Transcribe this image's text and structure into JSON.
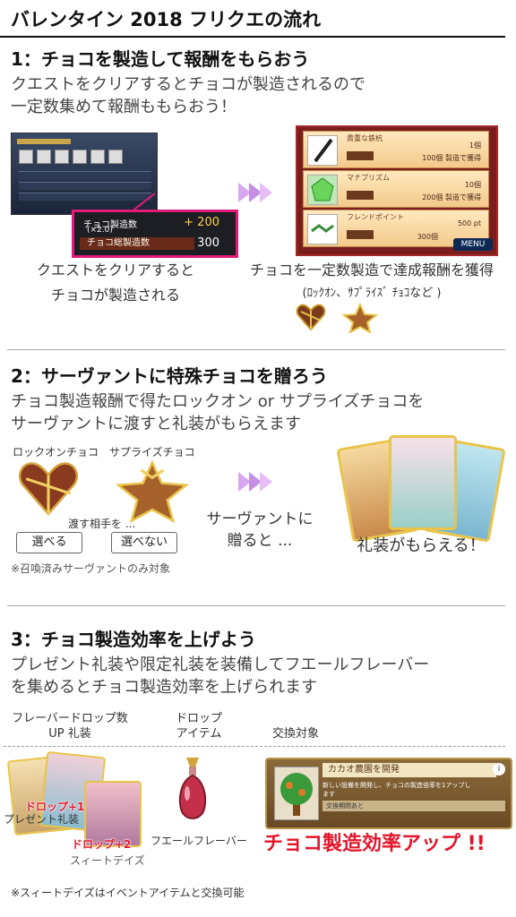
{
  "page": {
    "title": "バレンタイン 2018 フリクエの流れ"
  },
  "section1": {
    "heading": "1：チョコを製造して報酬をもらおう",
    "desc_line1": "クエストをクリアするとチョコが製造されるので",
    "desc_line2": "一定数集めて報酬ももらおう！",
    "panel": {
      "label1": "チョコ製造数",
      "label1b": "(×2.0)",
      "value1": "+ 200",
      "label2": "チョコ総製造数",
      "value2": "300"
    },
    "reward_screen": {
      "items": [
        {
          "name": "貴重な鉄杭",
          "qty": "1個",
          "progress": "100個 製造で獲得"
        },
        {
          "name": "マナプリズム",
          "qty": "10個",
          "progress": "200個 製造で獲得"
        },
        {
          "name": "フレンドポイント",
          "qty": "500 pt",
          "progress": "300個"
        }
      ],
      "menu_label": "MENU"
    },
    "caption_left_line1": "クエストをクリアすると",
    "caption_left_line2": "チョコが製造される",
    "caption_right_line1": "チョコを一定数製造で達成報酬を獲得",
    "caption_right_line2": "(ﾛｯｸｵﾝ、ｻﾌﾟﾗｲｽﾞ ﾁｮｺなど )"
  },
  "section2": {
    "heading": "2：サーヴァントに特殊チョコを贈ろう",
    "desc_line1": "チョコ製造報酬で得たロックオン or サプライズチョコを",
    "desc_line2": "サーヴァントに渡すと礼装がもらえます",
    "lockon_label": "ロックオンチョコ",
    "surprise_label": "サプライズチョコ",
    "pass_to_label": "渡す相手を ...",
    "can_choose": "選べる",
    "cannot_choose": "選べない",
    "note": "※召喚済みサーヴァントのみ対象",
    "give_caption_line1": "サーヴァントに",
    "give_caption_line2": "贈ると ...",
    "result_caption": "礼装がもらえる！"
  },
  "section3": {
    "heading": "3：チョコ製造効率を上げよう",
    "desc_line1": "プレゼント礼装や限定礼装を装備してフエールフレーバー",
    "desc_line2": "を集めるとチョコ製造効率を上げられます",
    "col1_line1": "フレーバードロップ数",
    "col1_line2": "UP 礼装",
    "col2_line1": "ドロップ",
    "col2_line2": "アイテム",
    "col3": "交換対象",
    "drop_plus1": "ドロップ+1",
    "present_essence": "プレゼント礼装",
    "drop_plus2": "ドロップ+2",
    "sweet_days": "スィートデイズ",
    "item_name": "フエールフレーバー",
    "exchange": {
      "title": "カカオ農園を開発",
      "desc_line1": "新しい設備を開発し、チョコの製造倍率を1アップし",
      "desc_line2": "ます",
      "strip": "交換期間あと"
    },
    "result": "チョコ製造効率アップ !!",
    "footnote": "※スィートデイズはイベントアイテムと交換可能"
  },
  "colors": {
    "accent_pink": "#e21a78",
    "red": "#e3152a",
    "arrow_purple": "#c58fe4"
  }
}
